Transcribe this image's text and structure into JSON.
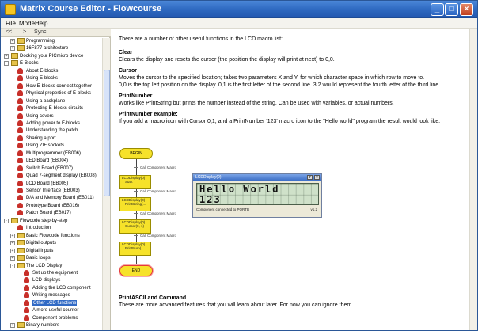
{
  "window": {
    "title": "Matrix Course Editor - Flowcourse"
  },
  "menu": [
    "File",
    "Mode",
    "Help"
  ],
  "nav": {
    "back": "<<",
    "forward": ">",
    "sync": "Sync"
  },
  "tree": [
    {
      "label": "Programming",
      "type": "book",
      "level": 1,
      "exp": "+"
    },
    {
      "label": "16F877 architecture",
      "type": "book",
      "level": 1,
      "exp": "+"
    },
    {
      "label": "Docking your PICmicro device",
      "type": "book",
      "level": 0,
      "exp": "+"
    },
    {
      "label": "E-Blocks",
      "type": "book",
      "level": 0,
      "exp": "-"
    },
    {
      "label": "About E-blocks",
      "type": "page",
      "level": 1
    },
    {
      "label": "Using E-blocks",
      "type": "page",
      "level": 1
    },
    {
      "label": "How E-blocks connect together",
      "type": "page",
      "level": 1
    },
    {
      "label": "Physical properties of E-blocks",
      "type": "page",
      "level": 1
    },
    {
      "label": "Using a backplane",
      "type": "page",
      "level": 1
    },
    {
      "label": "Protecting E-blocks circuits",
      "type": "page",
      "level": 1
    },
    {
      "label": "Using covers",
      "type": "page",
      "level": 1
    },
    {
      "label": "Adding power to E-blocks",
      "type": "page",
      "level": 1
    },
    {
      "label": "Understanding the patch",
      "type": "page",
      "level": 1
    },
    {
      "label": "Sharing a port",
      "type": "page",
      "level": 1
    },
    {
      "label": "Using ZIF sockets",
      "type": "page",
      "level": 1
    },
    {
      "label": "Multiprogrammer (EB006)",
      "type": "page",
      "level": 1
    },
    {
      "label": "LED Board (EB004)",
      "type": "page",
      "level": 1
    },
    {
      "label": "Switch Board (EB007)",
      "type": "page",
      "level": 1
    },
    {
      "label": "Quad 7-segment display (EB008)",
      "type": "page",
      "level": 1
    },
    {
      "label": "LCD Board (EB005)",
      "type": "page",
      "level": 1
    },
    {
      "label": "Sensor Interface (EB003)",
      "type": "page",
      "level": 1
    },
    {
      "label": "D/A and Memory Board (EB011)",
      "type": "page",
      "level": 1
    },
    {
      "label": "Prototype Board (EB016)",
      "type": "page",
      "level": 1
    },
    {
      "label": "Patch Board (EB017)",
      "type": "page",
      "level": 1
    },
    {
      "label": "Flowcode step-by-step",
      "type": "book",
      "level": 0,
      "exp": "-"
    },
    {
      "label": "Introduction",
      "type": "page",
      "level": 1
    },
    {
      "label": "Basic Flowcode functions",
      "type": "book",
      "level": 1,
      "exp": "+"
    },
    {
      "label": "Digital outputs",
      "type": "book",
      "level": 1,
      "exp": "+"
    },
    {
      "label": "Digital inputs",
      "type": "book",
      "level": 1,
      "exp": "+"
    },
    {
      "label": "Basic loops",
      "type": "book",
      "level": 1,
      "exp": "+"
    },
    {
      "label": "The LCD Display",
      "type": "book",
      "level": 1,
      "exp": "-"
    },
    {
      "label": "Set up the equipment",
      "type": "page",
      "level": 2
    },
    {
      "label": "LCD displays",
      "type": "page",
      "level": 2
    },
    {
      "label": "Adding the LCD component",
      "type": "page",
      "level": 2
    },
    {
      "label": "Writing messages",
      "type": "page",
      "level": 2
    },
    {
      "label": "Other LCD functions",
      "type": "page",
      "level": 2,
      "selected": true
    },
    {
      "label": "A more useful counter",
      "type": "page",
      "level": 2
    },
    {
      "label": "Component problems",
      "type": "page",
      "level": 2
    },
    {
      "label": "Binary numbers",
      "type": "book",
      "level": 1,
      "exp": "+"
    }
  ],
  "content": {
    "intro": "There are a number of other useful functions in the LCD macro list:",
    "clear_head": "Clear",
    "clear_text": "Clears the display and resets the cursor (the position the display will print at next) to 0,0.",
    "cursor_head": "Cursor",
    "cursor_text1": "Moves the cursor to the specified location; takes two parameters X and Y, for which character space in which row to move to.",
    "cursor_text2": "0,0 is the top left position on the display. 0,1 is the first letter of the second line. 3,2 would represent the fourth letter of the third line.",
    "printnum_head": "PrintNumber",
    "printnum_text": "Works like PrintString but prints the number instead of the string. Can be used with variables, or actual numbers.",
    "example_head": "PrintNumber example:",
    "example_text": "If you add a macro icon with Cursor 0,1, and a PrintNumber '123' macro icon to the \"Hello world\" program the result would look like:",
    "ascii_head": "PrintASCII and Command",
    "ascii_text": "These are more advanced features that you will learn about later. For now you can ignore them."
  },
  "diagram": {
    "begin": "BEGIN",
    "end": "END",
    "macros": [
      {
        "title": "LCDDisplay(0)",
        "sub": "Start",
        "comment": "Call Component Macro"
      },
      {
        "title": "LCDDisplay(0)",
        "sub": "PrintString(...",
        "comment": "Call Component Macro"
      },
      {
        "title": "LCDDisplay(0)",
        "sub": "Cursor(0, 1)",
        "comment": "Call Component Macro"
      },
      {
        "title": "LCDDisplay(0)",
        "sub": "PrintNum(...",
        "comment": "Call Component Macro"
      }
    ]
  },
  "lcd": {
    "title": "LCDDisplay(0)",
    "line1": "Hello World",
    "line2": "123",
    "status": "Component connected to PORTB",
    "version": "v1.2"
  },
  "colors": {
    "titlebar": "#2f6ac1",
    "selection": "#316ac5",
    "flow_yellow": "#f6e22a",
    "lcd_green": "#cfe1c9"
  }
}
